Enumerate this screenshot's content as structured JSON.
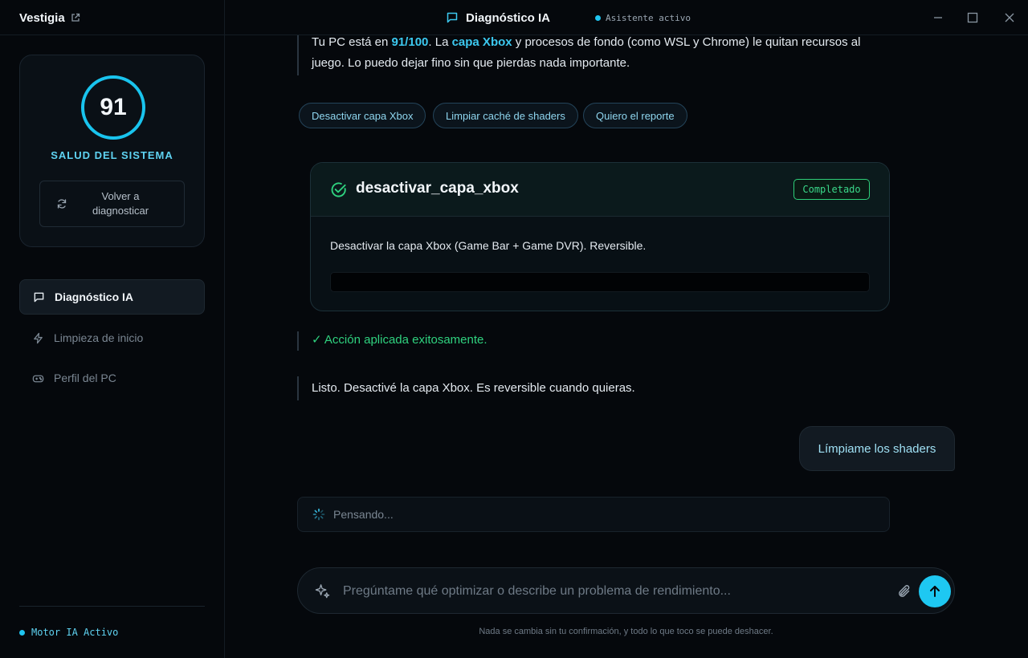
{
  "app": {
    "brand": "Vestigia",
    "title": "Diagnóstico IA",
    "assistant_status": "Asistente activo"
  },
  "sidebar": {
    "health": {
      "score": "91",
      "label": "SALUD DEL SISTEMA",
      "rediagnose_label": "Volver a diagnosticar"
    },
    "nav": [
      {
        "label": "Diagnóstico IA",
        "icon": "chat-icon",
        "active": true
      },
      {
        "label": "Limpieza de inicio",
        "icon": "bolt-icon",
        "active": false
      },
      {
        "label": "Perfil del PC",
        "icon": "gamepad-icon",
        "active": false
      }
    ],
    "engine_status": "Motor IA Activo"
  },
  "chat": {
    "intro": {
      "p1": "Tu PC está en ",
      "score": "91/100",
      "p2": ". La ",
      "layer": "capa Xbox",
      "p3": " y procesos de fondo (como WSL y Chrome) le quitan recursos al juego. Lo puedo dejar fino sin que pierdas nada importante."
    },
    "chips": [
      "Desactivar capa Xbox",
      "Limpiar caché de shaders",
      "Quiero el reporte"
    ],
    "tool": {
      "name": "desactivar_capa_xbox",
      "status": "Completado",
      "description": "Desactivar la capa Xbox (Game Bar + Game DVR). Reversible."
    },
    "success": "✓ Acción aplicada exitosamente.",
    "reply": "Listo. Desactivé la capa Xbox. Es reversible cuando quieras.",
    "user_message": "Límpiame los shaders",
    "thinking": "Pensando..."
  },
  "composer": {
    "placeholder": "Pregúntame qué optimizar o describe un problema de rendimiento...",
    "footnote": "Nada se cambia sin tu confirmación, y todo lo que toco se puede deshacer."
  },
  "colors": {
    "accent": "#1ec8f2",
    "success": "#2fd27f",
    "background": "#05080c"
  }
}
